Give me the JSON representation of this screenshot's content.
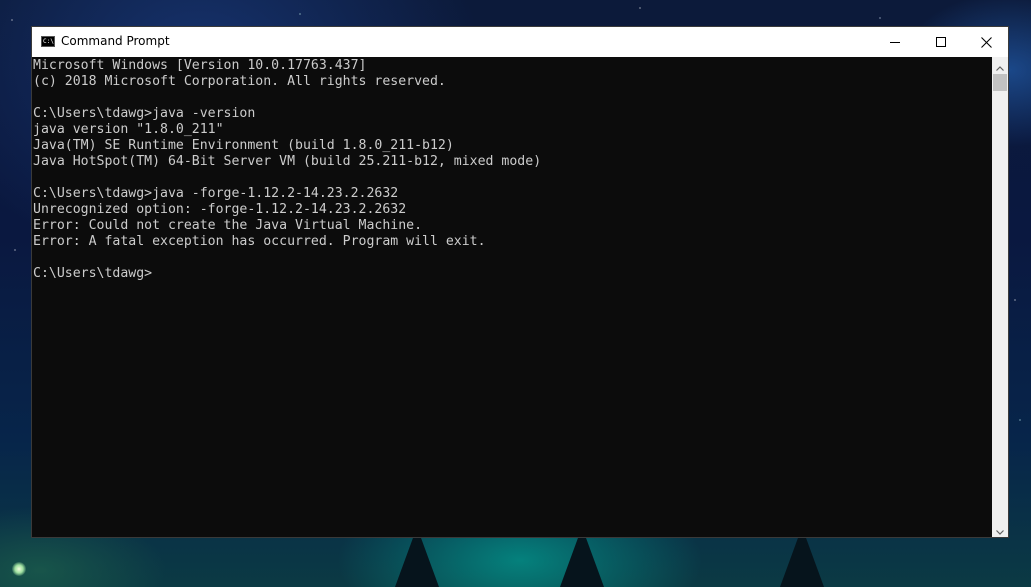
{
  "window": {
    "title": "Command Prompt",
    "icon": "cmd-icon",
    "controls": {
      "minimize": "minimize-icon",
      "maximize": "maximize-icon",
      "close": "close-icon"
    }
  },
  "console": {
    "lines": [
      "Microsoft Windows [Version 10.0.17763.437]",
      "(c) 2018 Microsoft Corporation. All rights reserved.",
      "",
      "C:\\Users\\tdawg>java -version",
      "java version \"1.8.0_211\"",
      "Java(TM) SE Runtime Environment (build 1.8.0_211-b12)",
      "Java HotSpot(TM) 64-Bit Server VM (build 25.211-b12, mixed mode)",
      "",
      "C:\\Users\\tdawg>java -forge-1.12.2-14.23.2.2632",
      "Unrecognized option: -forge-1.12.2-14.23.2.2632",
      "Error: Could not create the Java Virtual Machine.",
      "Error: A fatal exception has occurred. Program will exit.",
      "",
      "C:\\Users\\tdawg>"
    ]
  },
  "colors": {
    "console_background": "#0c0c0c",
    "console_text": "#cccccc",
    "titlebar": "#ffffff"
  }
}
